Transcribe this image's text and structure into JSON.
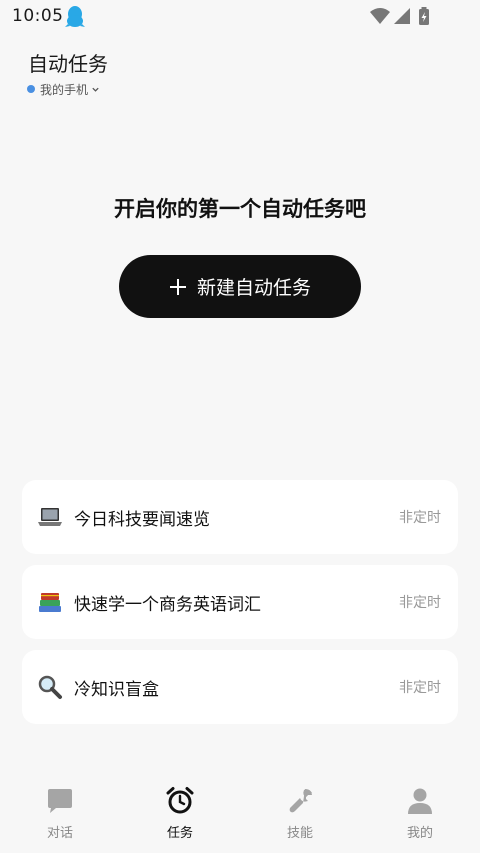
{
  "status_bar": {
    "time": "10:05",
    "icons": [
      "qq-icon",
      "wifi-icon",
      "signal-icon",
      "battery-icon"
    ]
  },
  "header": {
    "title": "自动任务",
    "device_label": "我的手机",
    "device_status_color": "#4a90e2"
  },
  "empty_state": {
    "title": "开启你的第一个自动任务吧",
    "new_task_label": "新建自动任务"
  },
  "tasks": [
    {
      "name": "今日科技要闻速览",
      "schedule": "非定时",
      "icon": "laptop-icon"
    },
    {
      "name": "快速学一个商务英语词汇",
      "schedule": "非定时",
      "icon": "books-icon"
    },
    {
      "name": "冷知识盲盒",
      "schedule": "非定时",
      "icon": "magnifier-icon"
    }
  ],
  "bottom_nav": {
    "items": [
      {
        "label": "对话",
        "icon": "chat-icon",
        "active": false
      },
      {
        "label": "任务",
        "icon": "alarm-clock-icon",
        "active": true
      },
      {
        "label": "技能",
        "icon": "wrench-icon",
        "active": false
      },
      {
        "label": "我的",
        "icon": "person-icon",
        "active": false
      }
    ]
  },
  "colors": {
    "background": "#f7f7f7",
    "button": "#111111",
    "card": "#ffffff",
    "muted_text": "#999999"
  }
}
